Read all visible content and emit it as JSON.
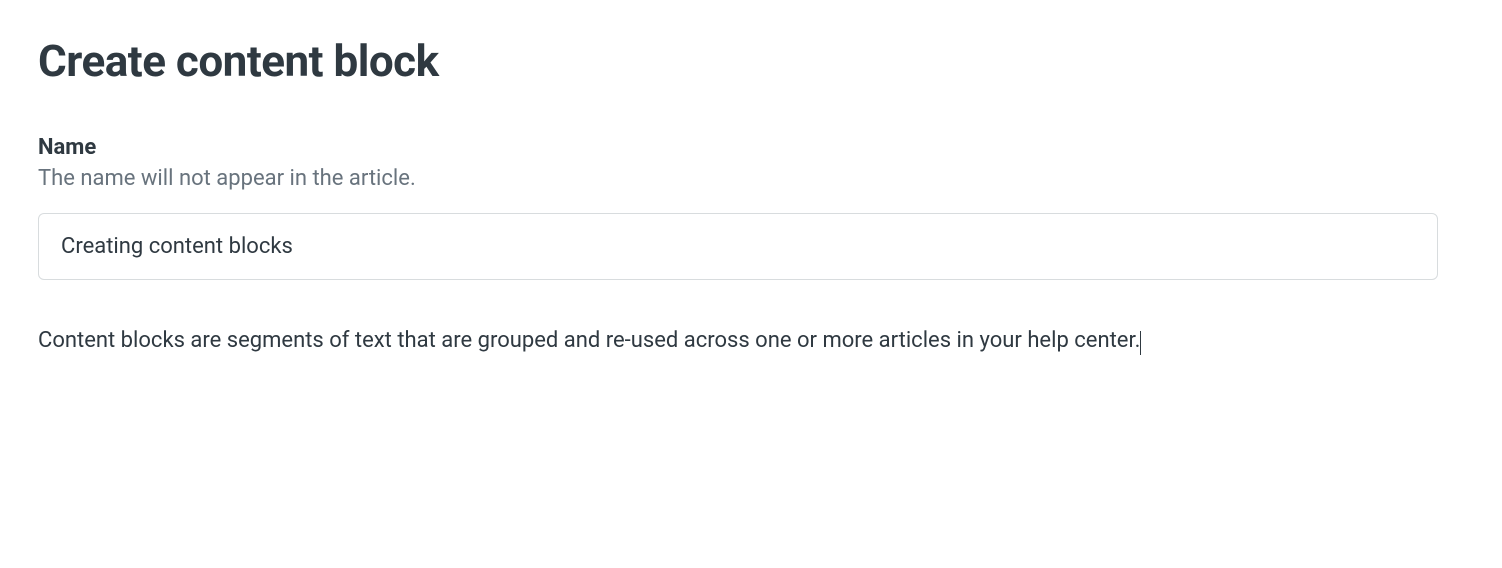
{
  "header": {
    "title": "Create content block"
  },
  "form": {
    "name": {
      "label": "Name",
      "help": "The name will not appear in the article.",
      "value": "Creating content blocks"
    }
  },
  "editor": {
    "body_text": "Content blocks are segments of text that are grouped and re-used across one or more articles in your help center."
  }
}
